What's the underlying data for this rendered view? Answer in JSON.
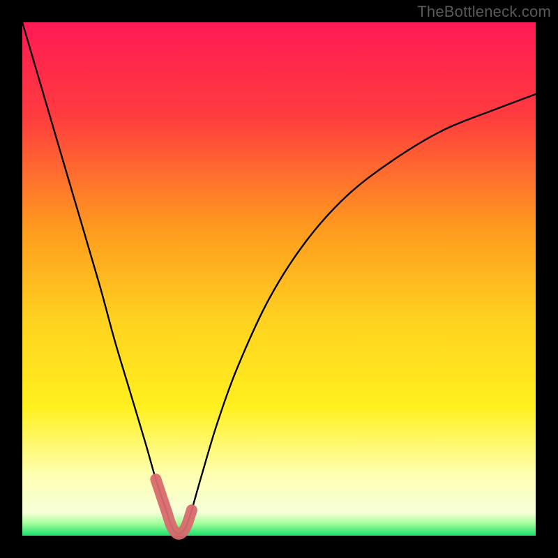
{
  "watermark": {
    "text": "TheBottleneck.com"
  },
  "chart_data": {
    "type": "line",
    "title": "",
    "xlabel": "",
    "ylabel": "",
    "xlim": [
      0,
      100
    ],
    "ylim": [
      0,
      100
    ],
    "x": [
      0,
      5,
      10,
      15,
      18,
      21,
      24,
      26,
      28,
      29,
      30,
      31,
      32,
      33,
      35,
      38,
      42,
      48,
      55,
      63,
      72,
      82,
      92,
      100
    ],
    "values": [
      100,
      83,
      66,
      49,
      38,
      28,
      18,
      11,
      5,
      2,
      0.5,
      0.5,
      2,
      5,
      12,
      22,
      33,
      46,
      57,
      66,
      73,
      79,
      83,
      86
    ],
    "highlight_range_x": [
      26,
      33
    ],
    "highlight_range_y_max": 11,
    "gradient_stops": [
      {
        "offset": 0.0,
        "color": "#ff1a55"
      },
      {
        "offset": 0.18,
        "color": "#ff3b3f"
      },
      {
        "offset": 0.4,
        "color": "#ff9a1f"
      },
      {
        "offset": 0.58,
        "color": "#ffd21f"
      },
      {
        "offset": 0.75,
        "color": "#fff01f"
      },
      {
        "offset": 0.88,
        "color": "#ffffb0"
      },
      {
        "offset": 0.955,
        "color": "#f6ffd9"
      },
      {
        "offset": 0.975,
        "color": "#a8ff9e"
      },
      {
        "offset": 1.0,
        "color": "#18e06a"
      }
    ],
    "curve_stroke": "#000000",
    "highlight_stroke": "#d86a6e"
  }
}
